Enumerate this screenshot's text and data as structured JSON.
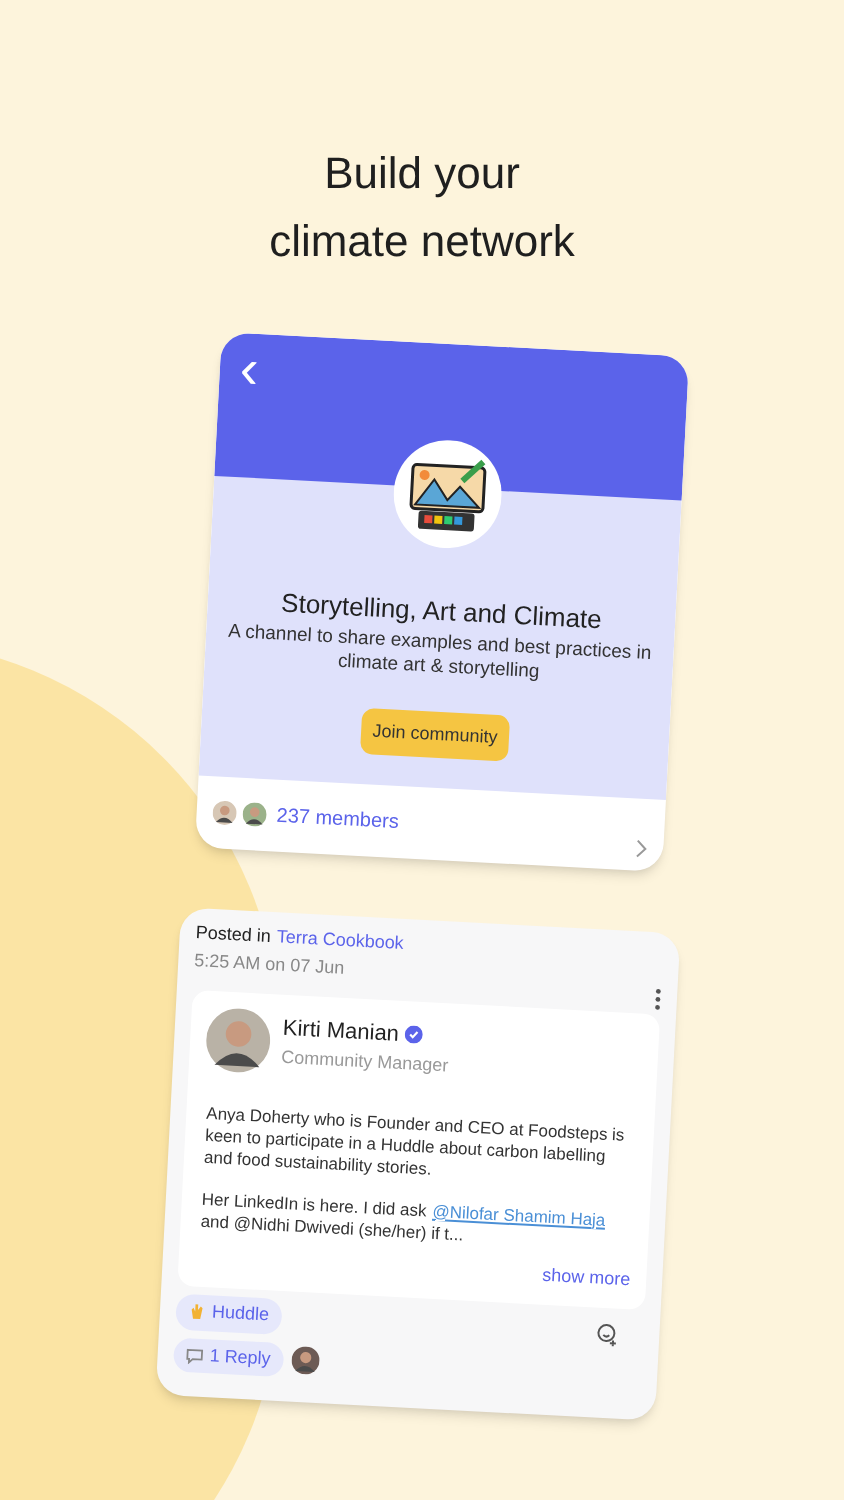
{
  "headline": [
    "Build your",
    "climate network"
  ],
  "channel_card": {
    "back": "‹",
    "name": "Storytelling, Art and Climate",
    "description": "A channel to share examples and best practices in climate art & storytelling",
    "join_button": "Join community",
    "members": "237 members"
  },
  "post_card": {
    "posted_in": "Posted in",
    "channel": "Terra Cookbook",
    "time": "5:25 AM on 07 Jun",
    "author": "Kirti Manian",
    "verified": true,
    "role": "Community Manager",
    "paragraph_1": "Anya Doherty who is Founder and CEO at Foodsteps is keen to participate in a Huddle about carbon labelling and food sustainability stories.",
    "paragraph_2_start": "Her LinkedIn is here. I did ask",
    "mention": "@Nilofar Shamim Haja",
    "paragraph_2_end": "and @Nidhi Dwivedi (she/her) if t...",
    "show_more": "show more",
    "reaction": "Huddle",
    "replies": "1 Reply"
  }
}
